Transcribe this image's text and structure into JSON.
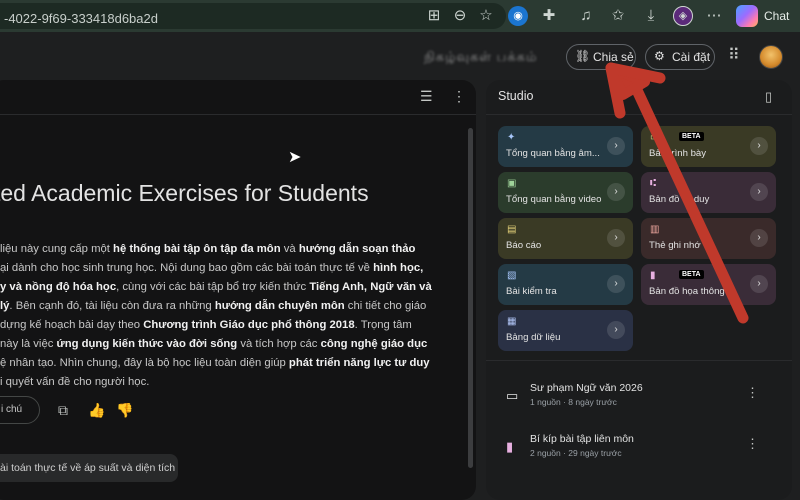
{
  "browser": {
    "url": "-4022-9f69-333418d6ba2d",
    "chat_label": "Chat",
    "icons": [
      "translate-icon",
      "zoom-icon",
      "bookmark-star-icon",
      "vpn-icon",
      "extensions-icon",
      "media-icon",
      "favorites-icon",
      "download-icon",
      "profile-icon",
      "more-icon",
      "copilot-icon"
    ]
  },
  "header": {
    "blurred_title": "நிகழ்வுகள் பக்கம்",
    "share_label": "Chia sẻ",
    "settings_label": "Cài đặt"
  },
  "document": {
    "title": "ted Academic Exercises for Students",
    "summary_lines": [
      {
        "parts": [
          {
            "t": "liệu này cung cấp một ",
            "b": false
          },
          {
            "t": "hệ thống bài tập ôn tập đa môn",
            "b": true
          },
          {
            "t": " và ",
            "b": false
          },
          {
            "t": "hướng dẫn soạn thảo",
            "b": true
          }
        ]
      },
      {
        "parts": [
          {
            "t": "ại dành cho học sinh trung học. Nội dung bao gồm các bài toán thực tế về ",
            "b": false
          },
          {
            "t": "hình học,",
            "b": true
          }
        ]
      },
      {
        "parts": [
          {
            "t": "y và nồng độ hóa học",
            "b": true
          },
          {
            "t": ", cùng với các bài tập bổ trợ kiến thức ",
            "b": false
          },
          {
            "t": "Tiếng Anh, Ngữ văn và",
            "b": true
          }
        ]
      },
      {
        "parts": [
          {
            "t": "lý",
            "b": true
          },
          {
            "t": ". Bên cạnh đó, tài liệu còn đưa ra những ",
            "b": false
          },
          {
            "t": "hướng dẫn chuyên môn",
            "b": true
          },
          {
            "t": " chi tiết cho giáo",
            "b": false
          }
        ]
      },
      {
        "parts": [
          {
            "t": " dựng kế hoạch bài dạy theo ",
            "b": false
          },
          {
            "t": "Chương trình Giáo dục phổ thông 2018",
            "b": true
          },
          {
            "t": ". Trọng tâm",
            "b": false
          }
        ]
      },
      {
        "parts": [
          {
            "t": " này là việc ",
            "b": false
          },
          {
            "t": "ứng dụng kiến thức vào đời sống",
            "b": true
          },
          {
            "t": " và tích hợp các ",
            "b": false
          },
          {
            "t": "công nghệ giáo dục",
            "b": true
          }
        ]
      },
      {
        "parts": [
          {
            "t": "ệ nhân tạo. Nhìn chung, đây là bộ học liệu toàn diện giúp ",
            "b": false
          },
          {
            "t": "phát triển năng lực tư duy",
            "b": true
          }
        ]
      },
      {
        "parts": [
          {
            "t": "i quyết vấn đề cho người học.",
            "b": false
          }
        ]
      }
    ],
    "save_note_label": "i chú",
    "suggestion": "ài toán thực tế về áp suất và diện tích"
  },
  "studio": {
    "title": "Studio",
    "tiles": [
      {
        "label": "Tổng quan bằng âm...",
        "icon": "✦",
        "bg": "#243a45",
        "icon_color": "#a8c7fa",
        "beta": false
      },
      {
        "label": "Bản trình bày",
        "icon": "▭",
        "bg": "#3a3a25",
        "icon_color": "#e6d37a",
        "beta": true
      },
      {
        "label": "Tổng quan bằng video",
        "icon": "▣",
        "bg": "#2b3c2c",
        "icon_color": "#9fd39a",
        "beta": false
      },
      {
        "label": "Bản đồ tư duy",
        "icon": "⑆",
        "bg": "#3a2c38",
        "icon_color": "#e7b0e0",
        "beta": false
      },
      {
        "label": "Báo cáo",
        "icon": "▤",
        "bg": "#3a3a25",
        "icon_color": "#e6d37a",
        "beta": false
      },
      {
        "label": "Thẻ ghi nhớ",
        "icon": "▥",
        "bg": "#3a2a2a",
        "icon_color": "#f0a8a0",
        "beta": false
      },
      {
        "label": "Bài kiểm tra",
        "icon": "▧",
        "bg": "#243a45",
        "icon_color": "#a8c7fa",
        "beta": false
      },
      {
        "label": "Bản đồ họa thông t...",
        "icon": "▮",
        "bg": "#3a2c38",
        "icon_color": "#e7b0e0",
        "beta": true
      },
      {
        "label": "Bảng dữ liệu",
        "icon": "▦",
        "bg": "#2a3145",
        "icon_color": "#b0c4f5",
        "beta": false
      }
    ],
    "beta_label": "BETA",
    "notes": [
      {
        "title": "Sư phạm Ngữ văn 2026",
        "meta": "1 nguồn · 8 ngày trước",
        "icon": "▭"
      },
      {
        "title": "Bí kíp bài tập liên môn",
        "meta": "2 nguồn · 29 ngày trước",
        "icon": "▮"
      }
    ]
  },
  "annotation": {
    "arrow_color": "#c0392b"
  }
}
